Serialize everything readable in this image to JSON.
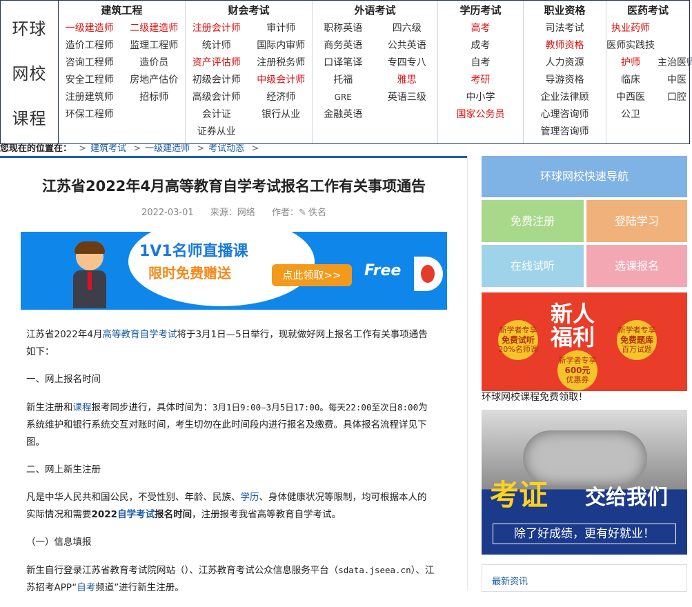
{
  "brand": {
    "lines": [
      "环球",
      "网校",
      "课程"
    ]
  },
  "nav": {
    "cols": [
      {
        "title": "建筑工程",
        "cols": 2,
        "width": 184,
        "items": [
          {
            "t": "一级建造师",
            "red": true
          },
          {
            "t": "二级建造师",
            "red": true
          },
          {
            "t": "造价工程师"
          },
          {
            "t": "监理工程师"
          },
          {
            "t": "咨询工程师"
          },
          {
            "t": "造价员"
          },
          {
            "t": "安全工程师"
          },
          {
            "t": "房地产估价"
          },
          {
            "t": "注册建筑师"
          },
          {
            "t": "招标师"
          },
          {
            "t": "环保工程师"
          }
        ]
      },
      {
        "title": "财会考试",
        "cols": 2,
        "width": 184,
        "items": [
          {
            "t": "注册会计师",
            "red": true
          },
          {
            "t": "审计师"
          },
          {
            "t": "统计师"
          },
          {
            "t": "国际内审师"
          },
          {
            "t": "资产评估师",
            "red": true
          },
          {
            "t": "注册税务师"
          },
          {
            "t": "初级会计师"
          },
          {
            "t": "中级会计师",
            "red": true
          },
          {
            "t": "高级会计师"
          },
          {
            "t": "经济师"
          },
          {
            "t": "会计证"
          },
          {
            "t": "银行从业"
          },
          {
            "t": "证券从业"
          }
        ]
      },
      {
        "title": "外语考试",
        "cols": 2,
        "width": 182,
        "items": [
          {
            "t": "职称英语"
          },
          {
            "t": "四六级"
          },
          {
            "t": "商务英语"
          },
          {
            "t": "公共英语"
          },
          {
            "t": "口译笔译"
          },
          {
            "t": "专四专八"
          },
          {
            "t": "托福"
          },
          {
            "t": "雅思",
            "red": true
          },
          {
            "t": "GRE",
            "small": true
          },
          {
            "t": "英语三级"
          },
          {
            "t": "金融英语"
          }
        ]
      },
      {
        "title": "学历考试",
        "cols": 1,
        "width": 124,
        "items": [
          {
            "t": "高考",
            "red": true
          },
          {
            "t": "成考"
          },
          {
            "t": "自考"
          },
          {
            "t": "考研",
            "red": true
          },
          {
            "t": "中小学"
          },
          {
            "t": "国家公务员",
            "red": true
          }
        ]
      },
      {
        "title": "职业资格",
        "cols": 1,
        "width": 120,
        "items": [
          {
            "t": "司法考试"
          },
          {
            "t": "教师资格",
            "red": true
          },
          {
            "t": "人力资源"
          },
          {
            "t": "导游资格"
          },
          {
            "t": "企业法律顾"
          },
          {
            "t": "心理咨询师"
          },
          {
            "t": "管理咨询师"
          }
        ]
      },
      {
        "title": "医药考试",
        "cols": 2,
        "width": 120,
        "items": [
          {
            "t": "执业药师",
            "red": true
          },
          {
            "t": ""
          },
          {
            "t": "医师实践技"
          },
          {
            "t": ""
          },
          {
            "t": "护师",
            "red": true
          },
          {
            "t": "主治医师"
          },
          {
            "t": "临床"
          },
          {
            "t": "中医"
          },
          {
            "t": "中西医"
          },
          {
            "t": "口腔"
          },
          {
            "t": "公卫"
          }
        ]
      }
    ]
  },
  "breadcrumb": {
    "label": "您现在的位置在：",
    "items": [
      "建筑考试",
      "一级建造师",
      "考试动态"
    ],
    "sep": ">"
  },
  "article": {
    "title": "江苏省2022年4月高等教育自学考试报名工作有关事项通告",
    "date": "2022-03-01",
    "source_label": "来源：网络",
    "author_label": "作者：",
    "author_icon": "pencil-icon",
    "author": "佚名",
    "p1a": "江苏省2022年4月",
    "p1link": "高等教育自学考试",
    "p1b": "将于3月1日—5日举行，现就做好网上报名工作有关事项通告如下：",
    "h1": "一、网上报名时间",
    "p2a": "新生注册和",
    "p2link": "课程",
    "p2b": "报考同步进行，具体时间为：",
    "p2mono1": "3月1日9:00—3月5日17:00。每天22:00至次日8:00",
    "p2c": "为系统维护和银行系统交互对账时间，考生切勿在此时间段内进行报名及缴费。具体报名流程详见下图。",
    "h2": "二、网上新生注册",
    "p3a": "凡是中华人民共和国公民，不受性别、年龄、民族、",
    "p3link": "学历",
    "p3b": "、身体健康状况等限制，均可根据本人的实际情况和需要",
    "p3bold": "2022",
    "p3link2": "自学考试",
    "p3bold2": "报名时间",
    "p3c": "，注册报考我省高等教育自学考试。",
    "h3": "（一）信息填报",
    "p4a": "新生自行登录江苏省教育考试院网站（）、江苏教育考试公众信息服务平台（",
    "p4mono": "sdata.jseea.cn",
    "p4b": "）、江苏招考APP“",
    "p4link": "自考",
    "p4c": "频道”进行新生注册。"
  },
  "banner": {
    "line1": "1V1名师直播课",
    "line2": "限时免费赠送",
    "button": "点此领取>>",
    "free": "Free"
  },
  "sidebar": {
    "nav_title": "环球网校快速导航",
    "tiles": [
      {
        "label": "免费注册",
        "color": "#a8d88a"
      },
      {
        "label": "登陆学习",
        "color": "#f0b27a"
      },
      {
        "label": "在线试听",
        "color": "#9fd3ea"
      },
      {
        "label": "选课报名",
        "color": "#f3a7b2"
      }
    ],
    "nav_color": "#7fb2e5",
    "ad1_title": "新人\n福利",
    "ad1_coin1": "新学者专享",
    "ad1_coin1b": "免费试听",
    "ad1_coin1c": "20%名师课",
    "ad1_coin2": "新学者专享",
    "ad1_coin2b": "免费题库",
    "ad1_coin2c": "百万试题",
    "ad1_coin3": "新学者专享",
    "ad1_coin3b": "600元",
    "ad1_coin3c": "优惠券",
    "ad1_caption": "环球网校课程免费领取！",
    "ad2_k1": "考证",
    "ad2_k2": "交给我们",
    "ad2_k3": "除了好成绩，更有好就业！",
    "news_title": "最新资讯"
  }
}
